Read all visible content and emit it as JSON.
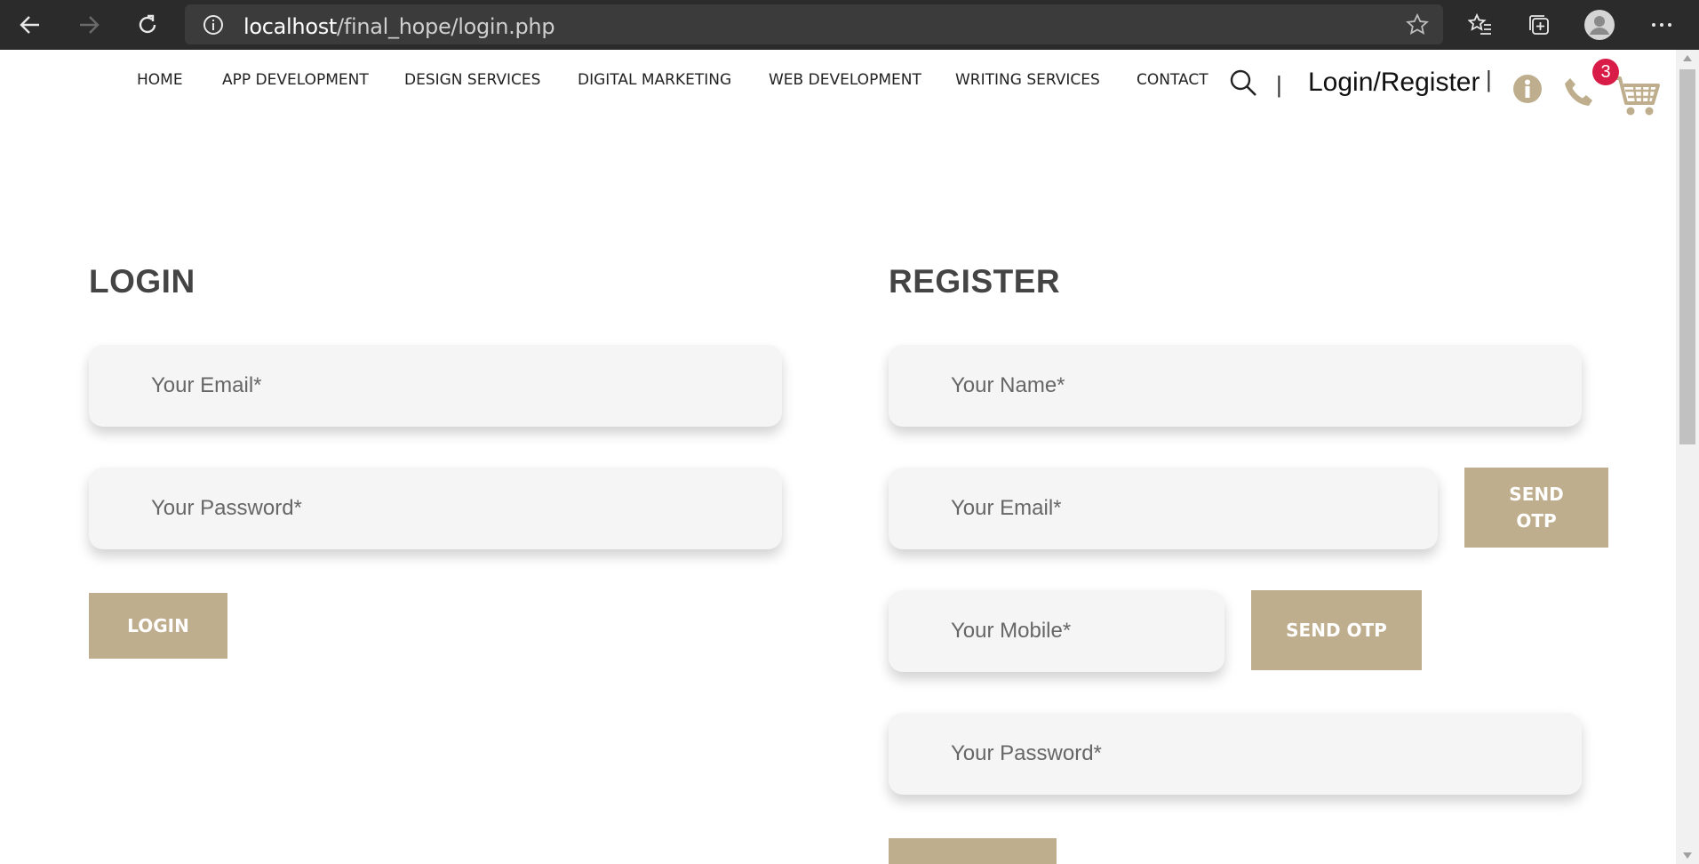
{
  "browser": {
    "url_host": "localhost",
    "url_path": "/final_hope/login.php",
    "icons": {
      "back": "arrow-left-icon",
      "forward": "arrow-right-icon",
      "reload": "reload-icon",
      "info": "info-circle-icon",
      "star": "star-icon",
      "favorites": "favorites-icon",
      "collections": "collections-icon",
      "profile": "profile-icon",
      "more": "more-icon"
    }
  },
  "nav": {
    "items": [
      "HOME",
      "APP DEVELOPMENT",
      "DESIGN SERVICES",
      "DIGITAL MARKETING",
      "WEB DEVELOPMENT",
      "WRITING SERVICES",
      "CONTACT"
    ],
    "divider": "|",
    "login_register": "Login/Register",
    "cart_count": "3"
  },
  "login": {
    "heading": "LOGIN",
    "email_placeholder": "Your Email*",
    "password_placeholder": "Your Password*",
    "button": "LOGIN"
  },
  "register": {
    "heading": "REGISTER",
    "name_placeholder": "Your Name*",
    "email_placeholder": "Your Email*",
    "email_otp_button_line1": "SEND",
    "email_otp_button_line2": "OTP",
    "mobile_placeholder": "Your Mobile*",
    "mobile_otp_button": "SEND OTP",
    "password_placeholder": "Your Password*"
  },
  "colors": {
    "accent": "#bfae8e",
    "badge": "#d81b47",
    "chrome": "#2b2b2b"
  }
}
